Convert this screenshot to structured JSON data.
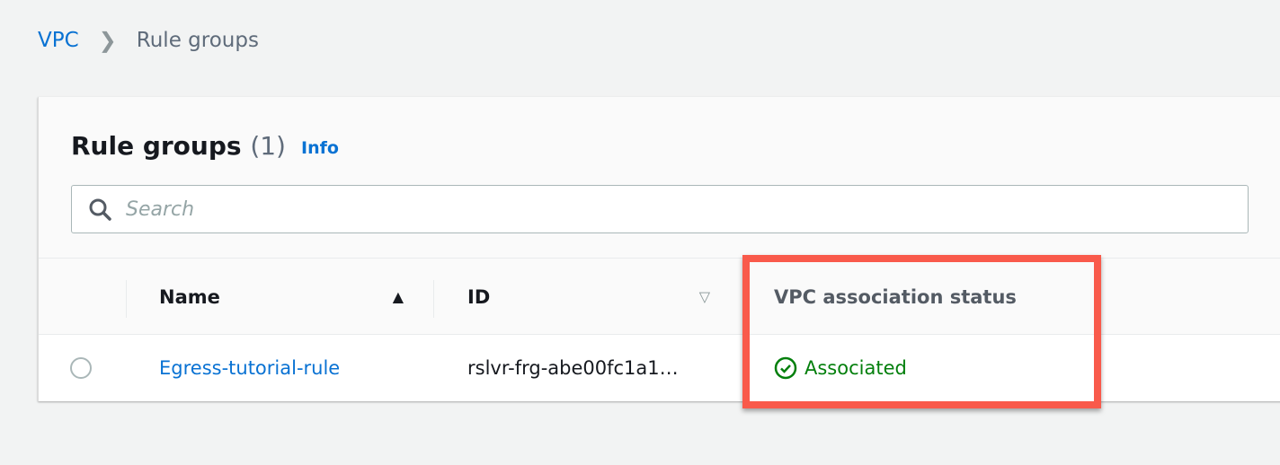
{
  "breadcrumb": {
    "root": "VPC",
    "current": "Rule groups"
  },
  "panel": {
    "title": "Rule groups",
    "count": "(1)",
    "info": "Info"
  },
  "search": {
    "placeholder": "Search",
    "value": ""
  },
  "table": {
    "columns": [
      {
        "label": "Name",
        "sort": "ascending"
      },
      {
        "label": "ID",
        "sort": "none"
      },
      {
        "label": "VPC association status"
      }
    ],
    "rows": [
      {
        "name": "Egress-tutorial-rule",
        "id": "rslvr-frg-abe00fc1a1…",
        "status": "Associated",
        "selected": false
      }
    ]
  },
  "colors": {
    "link": "#0972d3",
    "success": "#037f0c",
    "highlight": "#f95a4b"
  }
}
